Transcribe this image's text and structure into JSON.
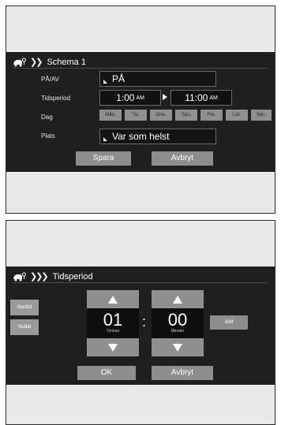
{
  "screen1": {
    "title": "Schema 1",
    "rows": {
      "onoff_label": "PÅ/AV",
      "onoff_value": "PÅ",
      "period_label": "Tidsperiod",
      "start_time": "1:00",
      "start_ampm": "AM",
      "end_time": "11:00",
      "end_ampm": "AM",
      "day_label": "Dag",
      "days": [
        "Mån.",
        "Tis.",
        "Ons.",
        "Tors.",
        "Fre.",
        "Lör.",
        "Sön."
      ],
      "place_label": "Plats",
      "place_value": "Var som helst"
    },
    "save_label": "Spara",
    "cancel_label": "Avbryt"
  },
  "screen2": {
    "title": "Tidsperiod",
    "start_label": "Starttid",
    "end_label": "Sluttid",
    "hours_value": "01",
    "hours_caption": "Timmar",
    "minutes_value": "00",
    "minutes_caption": "Minuter",
    "colon": ":",
    "ampm_label": "AM",
    "ok_label": "OK",
    "cancel_label": "Avbryt"
  },
  "icons": {
    "car": "car-settings-icon",
    "chevron": "double-chevron-right-icon"
  },
  "colors": {
    "screen_bg": "#1f1f1f",
    "button_gray": "#8d8d8d",
    "frame_bg": "#e9e9e9"
  }
}
